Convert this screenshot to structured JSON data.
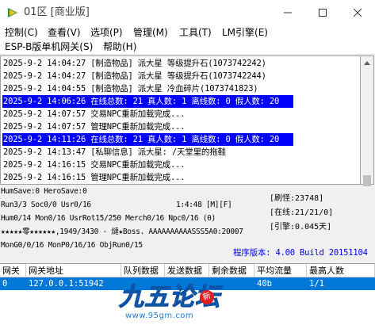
{
  "window": {
    "title": "01区 [商业版]"
  },
  "menu": {
    "row1": [
      "控制(C)",
      "查看(V)",
      "选项(P)",
      "管理(M)",
      "工具(T)",
      "LM引擎(E)"
    ],
    "row2": [
      "ESP-B版单机网关(S)",
      "帮助(H)"
    ]
  },
  "log": {
    "lines": [
      {
        "text": "2025-9-2 14:04:27 [制造物品] 派大星 等级提升石(1073742242)",
        "highlight": false
      },
      {
        "text": "2025-9-2 14:04:27 [制造物品] 派大星 等级提升石(1073742244)",
        "highlight": false
      },
      {
        "text": "2025-9-2 14:04:55 [制造物品] 派大星 冷血碎片(1073741823)",
        "highlight": false
      },
      {
        "text": "2025-9-2 14:06:26 在线总数: 21 真人数: 1 离线数: 0 假人数: 20",
        "highlight": true
      },
      {
        "text": "2025-9-2 14:07:57 交易NPC重新加载完成...",
        "highlight": false
      },
      {
        "text": "2025-9-2 14:07:57 管理NPC重新加载完成...",
        "highlight": false
      },
      {
        "text": "2025-9-2 14:11:26 在线总数: 21 真人数: 1 离线数: 0 假人数: 20",
        "highlight": true
      },
      {
        "text": "2025-9-2 14:13:47 [私聊信息] 派大星: /天堂里的拖鞋",
        "highlight": false
      },
      {
        "text": "2025-9-2 14:16:15 交易NPC重新加载完成...",
        "highlight": false
      },
      {
        "text": "2025-9-2 14:16:15 管理NPC重新加载完成...",
        "highlight": false
      }
    ]
  },
  "status": {
    "line1": "HumSave:0 HeroSave:0",
    "line2": "Run3/3 Soc0/0 Usr0/16",
    "line2_time": "1:4:48 [M][F]",
    "line3": "Hum0/14 Mon0/16 UsrRot15/250 Merch0/16 Npc0/16 (0)",
    "line4": "★★★★★零★★★★★★,1949/3430 - 燵★Boss. AAAAAAAAAASSS5A0:20007",
    "line5": "MonG0/0/16 MonP0/16/16 ObjRun0/15",
    "refresh": "[刷怪:23748]",
    "online": "[在线:21/21/0]",
    "engine": "[引擎:0.045天]",
    "version": "程序版本: 4.00 Build 20151104"
  },
  "table": {
    "headers": [
      "网关",
      "网关地址",
      "队列数据",
      "发送数据",
      "剩余数据",
      "平均流量",
      "最高人数"
    ],
    "rows": [
      [
        "0",
        "127.0.0.1:51942",
        "",
        "",
        "",
        "40b",
        "1/1"
      ]
    ]
  },
  "watermark": {
    "title": "九五论坛",
    "url": "www.95gm.com",
    "stamp": "新"
  },
  "colors": {
    "highlight_bg": "#0000ff",
    "selected_row": "#0078d7",
    "version_text": "#0000ee"
  }
}
